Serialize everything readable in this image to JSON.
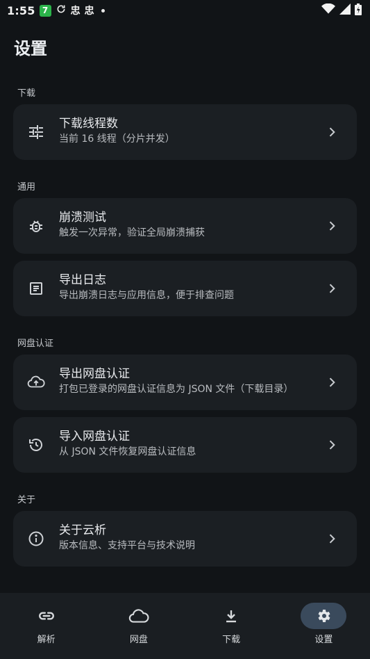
{
  "status_bar": {
    "time": "1:55",
    "badge": "7",
    "glyph_1": "忠",
    "glyph_2": "忠"
  },
  "page_title": "设置",
  "sections": {
    "download": {
      "label": "下载",
      "items": [
        {
          "title": "下载线程数",
          "subtitle": "当前 16 线程（分片并发）",
          "icon": "tune-sliders-icon"
        }
      ]
    },
    "general": {
      "label": "通用",
      "items": [
        {
          "title": "崩溃测试",
          "subtitle": "触发一次异常，验证全局崩溃捕获",
          "icon": "bug-icon"
        },
        {
          "title": "导出日志",
          "subtitle": "导出崩溃日志与应用信息，便于排查问题",
          "icon": "article-icon"
        }
      ]
    },
    "netdisk_auth": {
      "label": "网盘认证",
      "items": [
        {
          "title": "导出网盘认证",
          "subtitle": "打包已登录的网盘认证信息为 JSON 文件（下载目录）",
          "icon": "cloud-upload-icon"
        },
        {
          "title": "导入网盘认证",
          "subtitle": "从 JSON 文件恢复网盘认证信息",
          "icon": "history-icon"
        }
      ]
    },
    "about": {
      "label": "关于",
      "items": [
        {
          "title": "关于云析",
          "subtitle": "版本信息、支持平台与技术说明",
          "icon": "info-icon"
        }
      ]
    }
  },
  "bottom_nav": {
    "active": "settings",
    "items": [
      {
        "id": "parse",
        "label": "解析",
        "icon": "link-icon"
      },
      {
        "id": "netdisk",
        "label": "网盘",
        "icon": "cloud-icon"
      },
      {
        "id": "download",
        "label": "下载",
        "icon": "download-icon"
      },
      {
        "id": "settings",
        "label": "设置",
        "icon": "gear-icon"
      }
    ]
  },
  "colors": {
    "background": "#111417",
    "card": "#1b1f23",
    "nav_background": "#1a1e22",
    "nav_active_pill": "#3a4a5c",
    "badge_green": "#2bb34a"
  }
}
